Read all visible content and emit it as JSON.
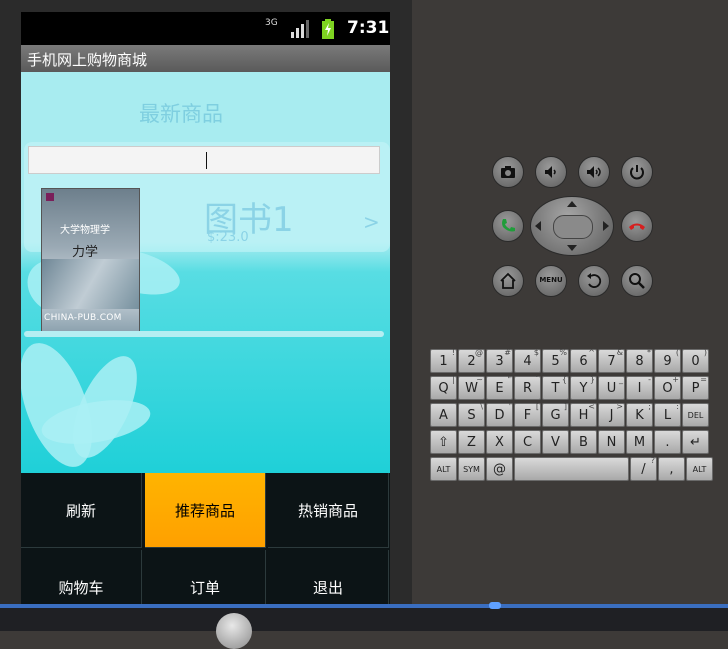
{
  "status_bar": {
    "network": "3G",
    "time": "7:31"
  },
  "app": {
    "title": "手机网上购物商城"
  },
  "main": {
    "section_title": "最新商品",
    "search_value": "",
    "product": {
      "name": "图书1",
      "price": "$:23.0",
      "arrow": ">"
    },
    "book_cover": {
      "title": "大学物理学",
      "subtitle": "力学",
      "footer": "CHINA-PUB.COM"
    }
  },
  "menu": {
    "items": [
      {
        "label": "刷新",
        "selected": false
      },
      {
        "label": "推荐商品",
        "selected": true
      },
      {
        "label": "热销商品",
        "selected": false
      },
      {
        "label": "购物车",
        "selected": false
      },
      {
        "label": "订单",
        "selected": false
      },
      {
        "label": "退出",
        "selected": false
      }
    ]
  },
  "emulator": {
    "top_buttons": [
      "camera",
      "volume-down",
      "volume-up",
      "power"
    ],
    "mid_buttons": [
      "call",
      "dpad",
      "end-call"
    ],
    "bottom_buttons": [
      "home",
      "menu",
      "back",
      "search"
    ],
    "menu_label": "MENU"
  },
  "keyboard": {
    "row1": [
      [
        "1",
        "!"
      ],
      [
        "2",
        "@"
      ],
      [
        "3",
        "#"
      ],
      [
        "4",
        "$"
      ],
      [
        "5",
        "%"
      ],
      [
        "6",
        "^"
      ],
      [
        "7",
        "&"
      ],
      [
        "8",
        "*"
      ],
      [
        "9",
        "("
      ],
      [
        "0",
        ")"
      ]
    ],
    "row2": [
      [
        "Q",
        "|"
      ],
      [
        "W",
        "~"
      ],
      [
        "E",
        "\""
      ],
      [
        "R",
        "`"
      ],
      [
        "T",
        "{"
      ],
      [
        "Y",
        "}"
      ],
      [
        "U",
        "_"
      ],
      [
        "I",
        "-"
      ],
      [
        "O",
        "+"
      ],
      [
        "P",
        "="
      ]
    ],
    "row3": [
      [
        "A",
        ""
      ],
      [
        "S",
        "\\"
      ],
      [
        "D",
        "'"
      ],
      [
        "F",
        "["
      ],
      [
        "G",
        "]"
      ],
      [
        "H",
        "<"
      ],
      [
        "J",
        ">"
      ],
      [
        "K",
        ";"
      ],
      [
        "L",
        ":"
      ],
      [
        "DEL",
        ""
      ]
    ],
    "row4": [
      [
        "⇧",
        ""
      ],
      [
        "Z",
        ""
      ],
      [
        "X",
        ""
      ],
      [
        "C",
        ""
      ],
      [
        "V",
        ""
      ],
      [
        "B",
        ""
      ],
      [
        "N",
        ""
      ],
      [
        "M",
        ""
      ],
      [
        ".",
        ""
      ],
      [
        "↵",
        ""
      ]
    ],
    "row5": [
      [
        "ALT",
        ""
      ],
      [
        "SYM",
        ""
      ],
      [
        "@",
        ""
      ],
      [
        "",
        ""
      ],
      [
        "/",
        "?"
      ],
      [
        ",",
        ""
      ],
      [
        "ALT",
        ""
      ]
    ]
  },
  "colors": {
    "accent_selected": "#ffa800",
    "content_bg": "#a8ecf0",
    "menu_bg": "#0c1416"
  }
}
